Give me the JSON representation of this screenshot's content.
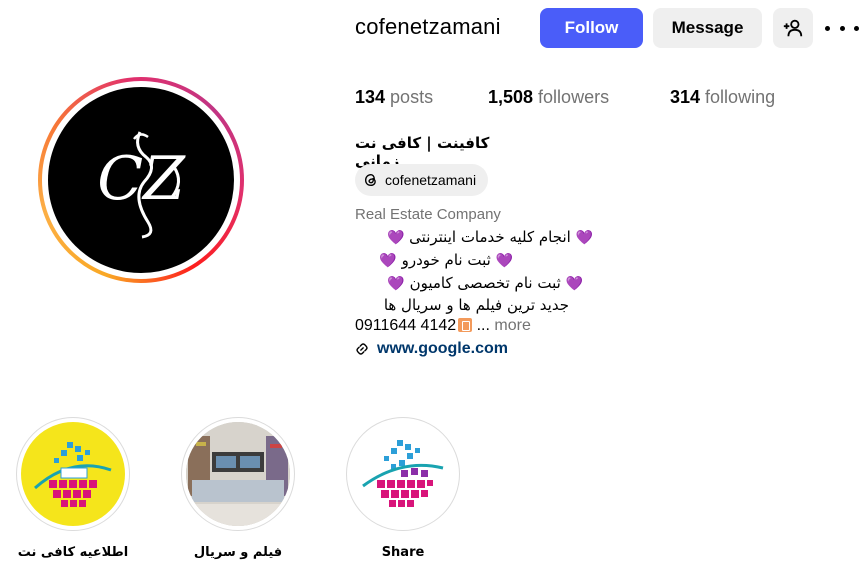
{
  "profile": {
    "username": "cofenetzamani",
    "full_name": "کافینت | کافی نت زمانی",
    "threads_handle": "cofenetzamani",
    "category": "Real Estate Company",
    "avatar_monogram": "CZ"
  },
  "actions": {
    "follow_label": "Follow",
    "message_label": "Message",
    "suggest_icon": "person-plus-icon",
    "more_icon": "more-dots-icon"
  },
  "stats": {
    "posts_count": "134",
    "posts_label": "posts",
    "followers_count": "1,508",
    "followers_label": "followers",
    "following_count": "314",
    "following_label": "following"
  },
  "bio": {
    "lines": [
      "انجام کلیه خدمات اینترنتی",
      "ثبت نام خودرو",
      "ثبت نام تخصصی کامیون",
      "جدید ترین فیلم ها و سریال ها"
    ],
    "heart_icon": "💜",
    "phone": "0911644 4142",
    "ellipsis": "...",
    "more_label": "more",
    "link": "www.google.com"
  },
  "highlights": [
    {
      "label": "اطلاعیه کافی نت",
      "icon": "globe-logo-yellow"
    },
    {
      "label": "فیلم و سریال",
      "icon": "shop-photo"
    },
    {
      "label": "Share",
      "icon": "globe-logo-white"
    }
  ],
  "colors": {
    "follow_bg": "#4a5df9",
    "secondary_bg": "#efefef",
    "link": "#00376b",
    "muted": "#737373",
    "heart": "#8e3bd9"
  }
}
